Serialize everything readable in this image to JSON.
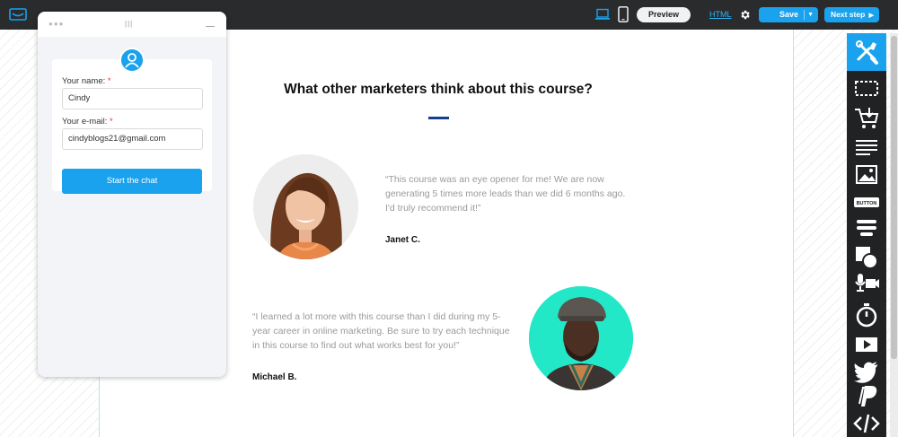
{
  "topbar": {
    "preview_label": "Preview",
    "html_label": "HTML",
    "save_label": "Save",
    "next_label": "Next step",
    "icons": [
      "logo-icon",
      "desktop-icon",
      "mobile-icon",
      "gear-icon",
      "chevron-down-icon",
      "chevron-right-icon"
    ]
  },
  "section": {
    "title": "What other marketers think about this course?"
  },
  "testimonials": [
    {
      "quote_lines": [
        "“This course was an eye opener for me! We are now",
        "generating 5 times more leads than we did 6 months ago.",
        "I'd truly recommend it!”"
      ],
      "author": "Janet C."
    },
    {
      "quote_lines": [
        "“I learned a lot more with this course than I did during my 5-",
        "year career in online marketing. Be sure to try each technique",
        "in this course to find out what works best for you!”"
      ],
      "author": "Michael B."
    }
  ],
  "chat": {
    "name_label": "Your name:",
    "name_value": "Cindy",
    "email_label": "Your e-mail:",
    "email_value": "cindyblogs21@gmail.com",
    "required_mark": "*",
    "button_label": "Start the chat"
  },
  "toolbar": {
    "tools": [
      "tools-icon",
      "section-icon",
      "cart-icon",
      "text-icon",
      "image-icon",
      "button-icon",
      "form-icon",
      "shapes-icon",
      "video-icon",
      "timer-icon",
      "youtube-icon",
      "twitter-icon",
      "paypal-icon",
      "code-icon"
    ],
    "button_tool_label": "BUTTON"
  },
  "colors": {
    "accent": "#1aa2ee",
    "topbar": "#2a2b2d",
    "toolbar": "#212224",
    "title_rule": "#1b3d8f",
    "avatar_bg_2": "#22e8c8"
  }
}
